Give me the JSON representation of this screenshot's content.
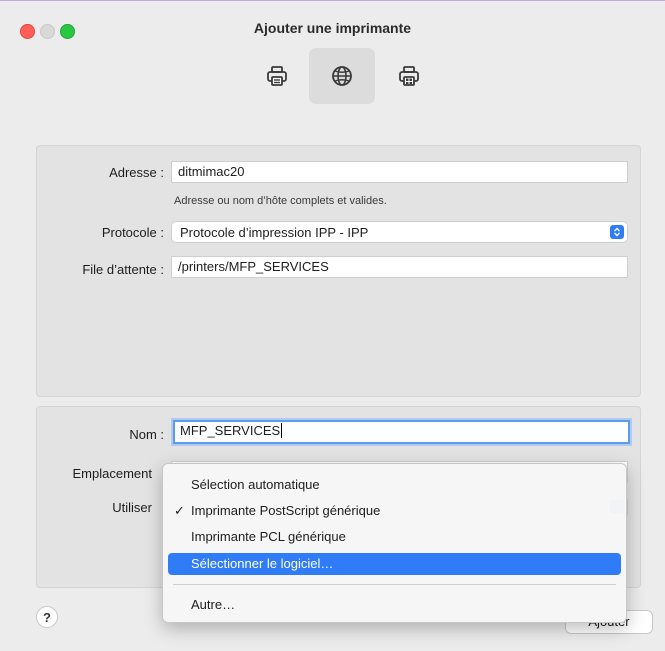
{
  "window": {
    "title": "Ajouter une imprimante"
  },
  "toolbar": {
    "items": [
      {
        "icon": "printer-icon",
        "selected": false
      },
      {
        "icon": "globe-icon",
        "selected": true
      },
      {
        "icon": "windows-printer-icon",
        "selected": false
      }
    ]
  },
  "form": {
    "address_label": "Adresse :",
    "address_value": "ditmimac20",
    "address_help": "Adresse ou nom d’hôte complets et valides.",
    "protocol_label": "Protocole :",
    "protocol_value": "Protocole d’impression IPP - IPP",
    "queue_label": "File d’attente :",
    "queue_value": "/printers/MFP_SERVICES",
    "name_label": "Nom :",
    "name_value": "MFP_SERVICES",
    "location_label": "Emplacement",
    "use_label": "Utiliser"
  },
  "menu": {
    "items": [
      {
        "label": "Sélection automatique",
        "checked": false,
        "highlighted": false
      },
      {
        "label": "Imprimante PostScript générique",
        "checked": true,
        "highlighted": false
      },
      {
        "label": "Imprimante PCL générique",
        "checked": false,
        "highlighted": false
      },
      {
        "label": "Sélectionner le logiciel…",
        "checked": false,
        "highlighted": true
      },
      {
        "label": "Autre…",
        "checked": false,
        "highlighted": false
      }
    ],
    "check_glyph": "✓"
  },
  "buttons": {
    "help": "?",
    "add": "Ajouter"
  },
  "colors": {
    "accent": "#2f7cf6",
    "close": "#ff5f57",
    "maximize": "#28c840"
  }
}
